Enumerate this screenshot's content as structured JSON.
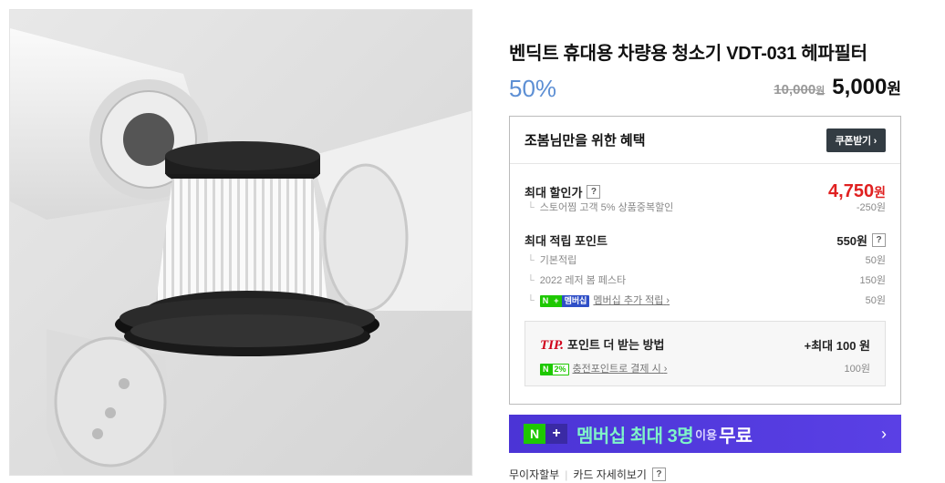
{
  "product": {
    "title": "벤딕트 휴대용 차량용 청소기 VDT-031 헤파필터",
    "discount_rate": "50%",
    "original_price": "10,000",
    "original_price_unit": "원",
    "sale_price": "5,000",
    "sale_price_unit": "원"
  },
  "benefit": {
    "title": "조봄님만을 위한 혜택",
    "coupon_button": "쿠폰받기",
    "max_discount_label": "최대 할인가",
    "max_discount_price": "4,750",
    "max_discount_unit": "원",
    "store_discount_label": "스토어찜 고객 5% 상품중복할인",
    "store_discount_value": "-250원",
    "max_points_label": "최대 적립 포인트",
    "max_points_value": "550원",
    "points": [
      {
        "label": "기본적립",
        "value": "50원"
      },
      {
        "label": "2022 레저 봄 페스타",
        "value": "150원"
      }
    ],
    "membership_label": "멤버십 추가 적립",
    "membership_value": "50원",
    "help_mark": "?",
    "tree_mark": "└"
  },
  "tip": {
    "tip_word": "TIP.",
    "label": "포인트 더 받는 방법",
    "max_label": "+최대 100 원",
    "charge_label": "충전포인트로 결제 시",
    "charge_value": "100원",
    "charge_badge": "2%"
  },
  "badges": {
    "naver": "N",
    "plus": "+",
    "membership": "멤버십"
  },
  "banner": {
    "text1": "멤버십 최대 3명",
    "text2": "이용",
    "text3": "무료"
  },
  "bottom": {
    "installment": "무이자할부",
    "card_detail": "카드 자세히보기"
  },
  "colors": {
    "discount_rate": "#5d8fd4",
    "max_price": "#e02020",
    "banner": "#5a40e5",
    "naver_green": "#1ec800"
  },
  "icons": {
    "chevron": "chevron-right-icon"
  }
}
